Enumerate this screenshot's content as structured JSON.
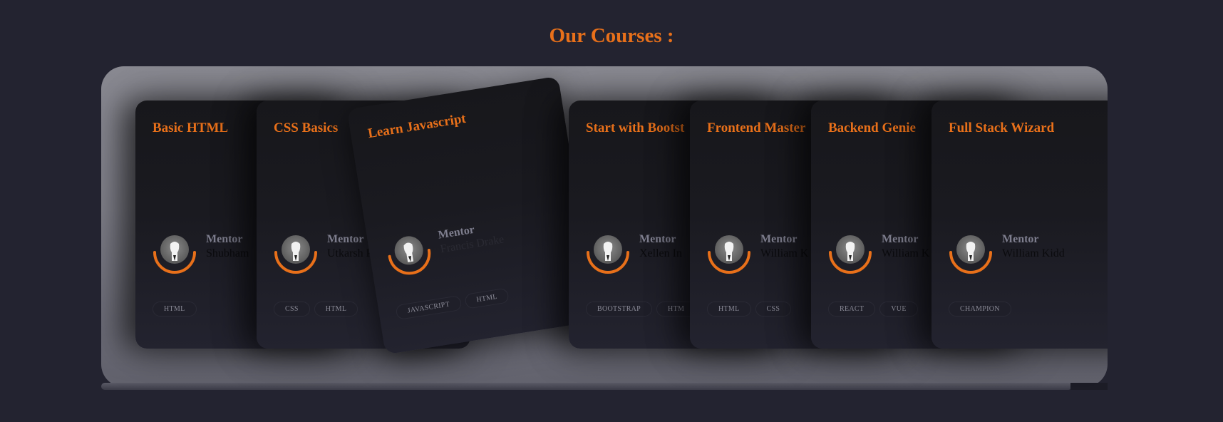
{
  "section_title": "Our Courses :",
  "mentor_label": "Mentor",
  "colors": {
    "accent": "#e8701a",
    "background": "#232330",
    "card": "#1a1a20"
  },
  "cards": [
    {
      "title": "Basic HTML",
      "mentor": "Shubham",
      "tags": [
        "HTML"
      ]
    },
    {
      "title": "CSS Basics",
      "mentor": "Utkarsh Pa",
      "tags": [
        "CSS",
        "HTML"
      ]
    },
    {
      "title": "Learn Javascript",
      "mentor": "Francis Drake",
      "tags": [
        "JAVASCRIPT",
        "HTML"
      ]
    },
    {
      "title": "Start with Bootst",
      "mentor": "Xellen In",
      "tags": [
        "BOOTSTRAP",
        "HTM"
      ]
    },
    {
      "title": "Frontend Master",
      "mentor": "William K",
      "tags": [
        "HTML",
        "CSS"
      ]
    },
    {
      "title": "Backend Genie",
      "mentor": "William K",
      "tags": [
        "REACT",
        "VUE"
      ]
    },
    {
      "title": "Full Stack Wizard",
      "mentor": "William Kidd",
      "tags": [
        "CHAMPION"
      ]
    }
  ]
}
